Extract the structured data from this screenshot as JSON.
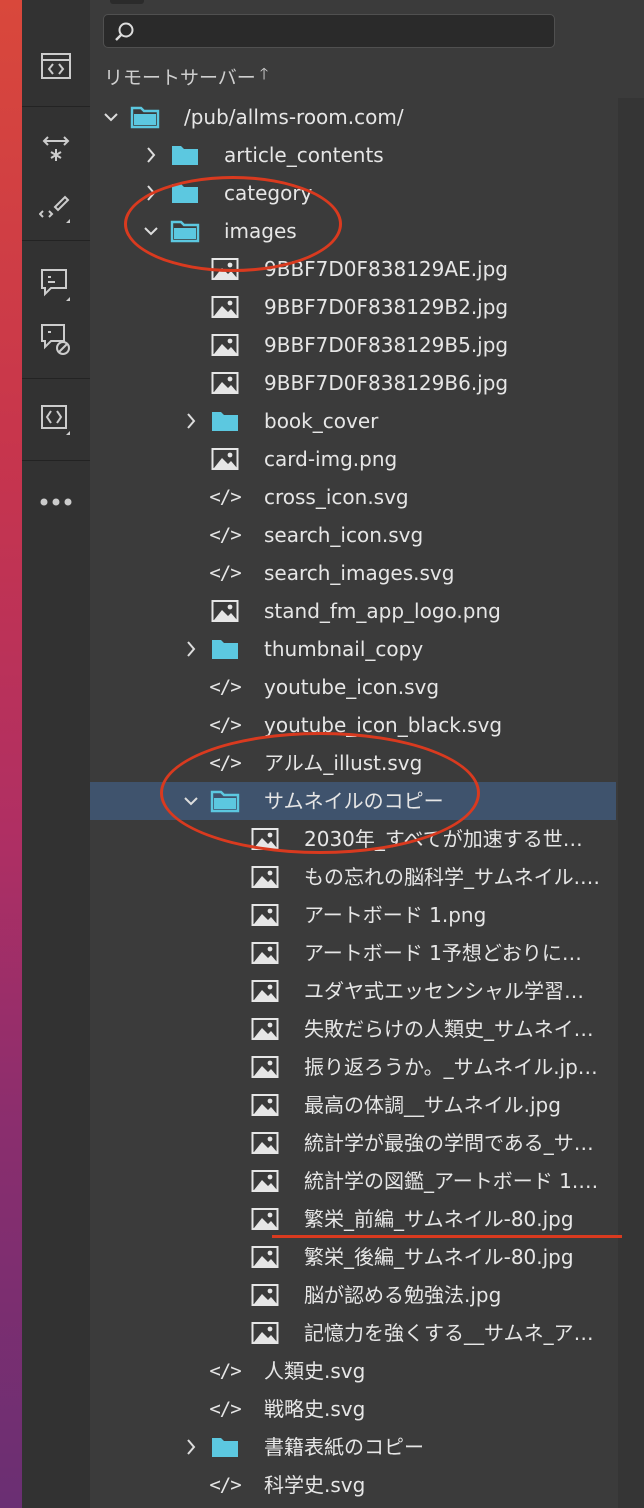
{
  "panel": {
    "search": {
      "placeholder": "",
      "value": ""
    },
    "header": {
      "title": "リモートサーバー",
      "sort_icon": "arrow-up"
    }
  },
  "toolbar": {
    "buttons": [
      "code-view-icon",
      "transform-icon",
      "code-hint-icon",
      "comment-icon",
      "comment-clear-icon",
      "code-panel-icon",
      "more-icon"
    ]
  },
  "tree": [
    {
      "label": "/pub/allms-room.com/",
      "type": "folder",
      "depth": 0,
      "expanded": true
    },
    {
      "label": "article_contents",
      "type": "folder",
      "depth": 1,
      "expanded": false
    },
    {
      "label": "category",
      "type": "folder",
      "depth": 1,
      "expanded": false
    },
    {
      "label": "images",
      "type": "folder",
      "depth": 1,
      "expanded": true
    },
    {
      "label": "9BBF7D0F838129AE.jpg",
      "type": "image",
      "depth": 2
    },
    {
      "label": "9BBF7D0F838129B2.jpg",
      "type": "image",
      "depth": 2
    },
    {
      "label": "9BBF7D0F838129B5.jpg",
      "type": "image",
      "depth": 2
    },
    {
      "label": "9BBF7D0F838129B6.jpg",
      "type": "image",
      "depth": 2
    },
    {
      "label": "book_cover",
      "type": "folder",
      "depth": 2,
      "expanded": false
    },
    {
      "label": "card-img.png",
      "type": "image",
      "depth": 2
    },
    {
      "label": "cross_icon.svg",
      "type": "code",
      "depth": 2
    },
    {
      "label": "search_icon.svg",
      "type": "code",
      "depth": 2
    },
    {
      "label": "search_images.svg",
      "type": "code",
      "depth": 2
    },
    {
      "label": "stand_fm_app_logo.png",
      "type": "image",
      "depth": 2
    },
    {
      "label": "thumbnail_copy",
      "type": "folder",
      "depth": 2,
      "expanded": false
    },
    {
      "label": "youtube_icon.svg",
      "type": "code",
      "depth": 2
    },
    {
      "label": "youtube_icon_black.svg",
      "type": "code",
      "depth": 2
    },
    {
      "label": "アルム_illust.svg",
      "type": "code",
      "depth": 2
    },
    {
      "label": "サムネイルのコピー",
      "type": "folder",
      "depth": 2,
      "expanded": true,
      "selected": true
    },
    {
      "label": "2030年_すべてが加速する世…",
      "type": "image",
      "depth": 3
    },
    {
      "label": "もの忘れの脳科学_サムネイル.…",
      "type": "image",
      "depth": 3
    },
    {
      "label": "アートボード 1.png",
      "type": "image",
      "depth": 3
    },
    {
      "label": "アートボード 1予想どおりに…",
      "type": "image",
      "depth": 3
    },
    {
      "label": "ユダヤ式エッセンシャル学習…",
      "type": "image",
      "depth": 3
    },
    {
      "label": "失敗だらけの人類史_サムネイ…",
      "type": "image",
      "depth": 3
    },
    {
      "label": "振り返ろうか。_サムネイル.jp…",
      "type": "image",
      "depth": 3
    },
    {
      "label": "最高の体調__サムネイル.jpg",
      "type": "image",
      "depth": 3
    },
    {
      "label": "統計学が最強の学問である_サ…",
      "type": "image",
      "depth": 3
    },
    {
      "label": "統計学の図鑑_アートボード 1.…",
      "type": "image",
      "depth": 3
    },
    {
      "label": "繁栄_前編_サムネイル-80.jpg",
      "type": "image",
      "depth": 3
    },
    {
      "label": "繁栄_後編_サムネイル-80.jpg",
      "type": "image",
      "depth": 3
    },
    {
      "label": "脳が認める勉強法.jpg",
      "type": "image",
      "depth": 3
    },
    {
      "label": "記憶力を強くする__サムネ_ア…",
      "type": "image",
      "depth": 3
    },
    {
      "label": "人類史.svg",
      "type": "code",
      "depth": 2
    },
    {
      "label": "戦略史.svg",
      "type": "code",
      "depth": 2
    },
    {
      "label": "書籍表紙のコピー",
      "type": "folder",
      "depth": 2,
      "expanded": false
    },
    {
      "label": "科学史.svg",
      "type": "code",
      "depth": 2
    }
  ],
  "colors": {
    "folder": "#5cc8e0",
    "selection": "#3f536d",
    "annotation": "#d93a1f",
    "text": "#e6e6e6"
  }
}
